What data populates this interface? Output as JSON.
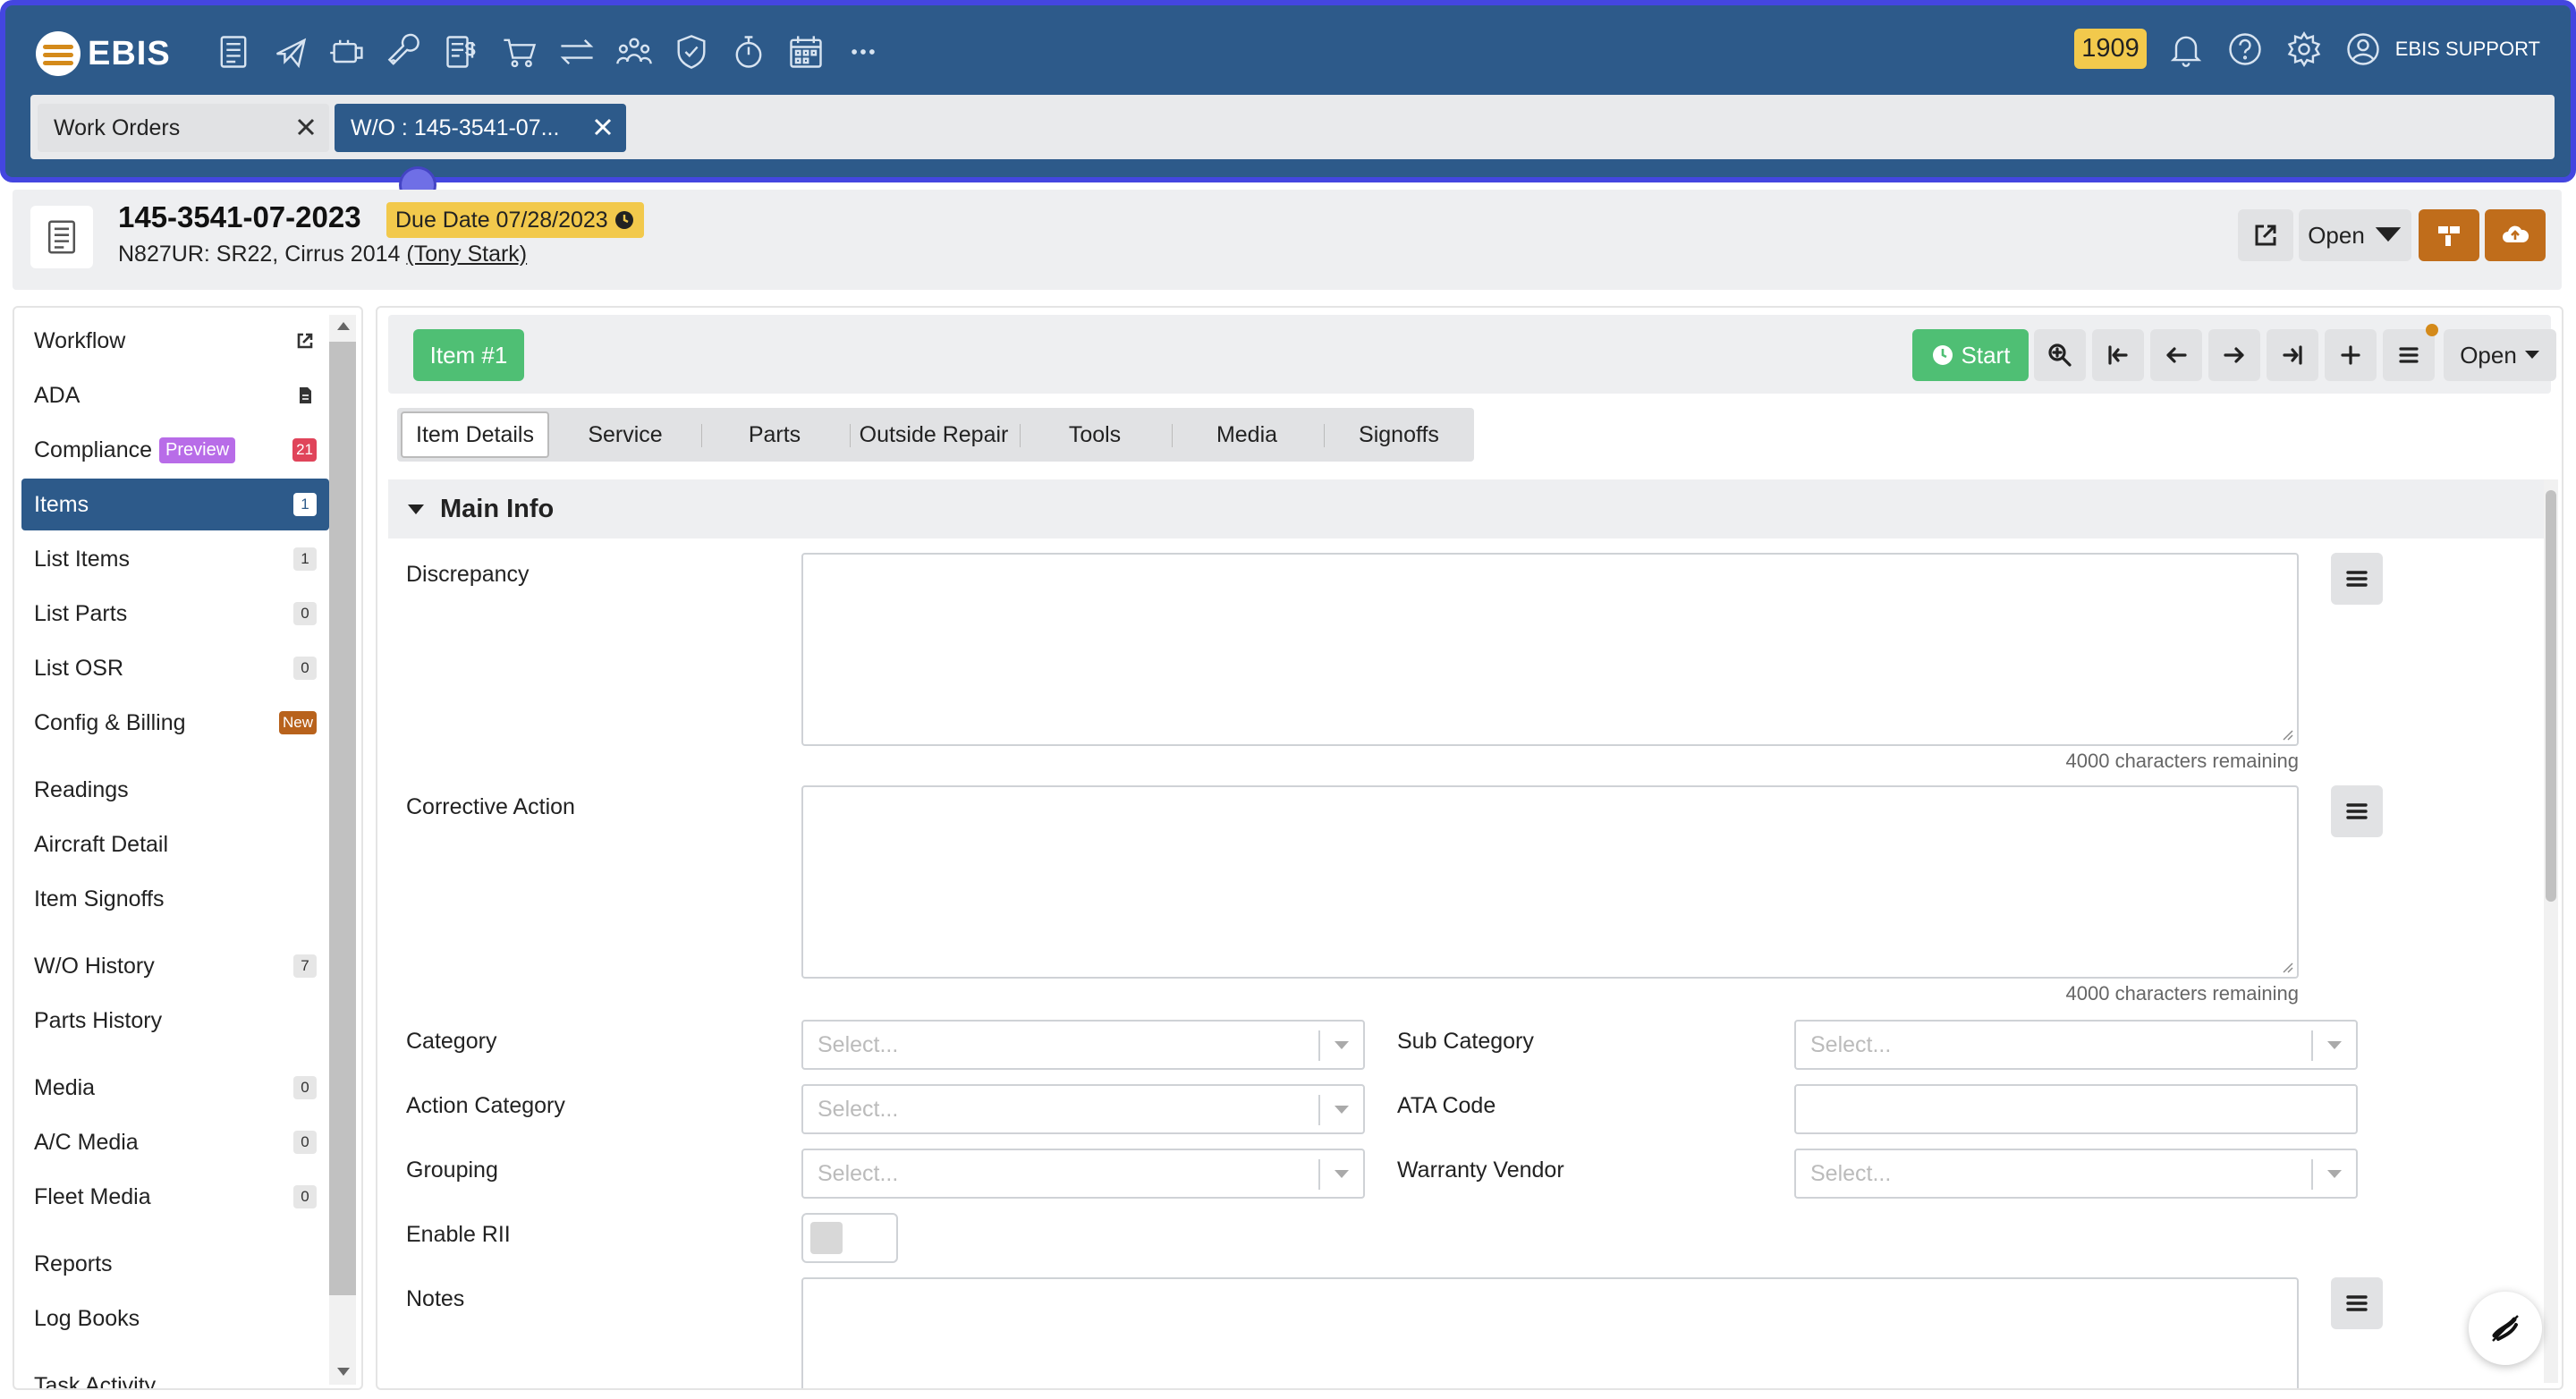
{
  "app": {
    "logo_text": "EBIS"
  },
  "topbar": {
    "nav_icons": [
      "document-icon",
      "airplane-icon",
      "engine-icon",
      "wrench-icon",
      "invoice-icon",
      "cart-icon",
      "transfer-icon",
      "people-icon",
      "shield-icon",
      "stopwatch-icon",
      "calendar-icon",
      "more-icon"
    ],
    "badge_count": "1909",
    "user_name": "EBIS SUPPORT"
  },
  "window_tabs": [
    {
      "label": "Work Orders",
      "active": false
    },
    {
      "label": "W/O : 145-3541-07...",
      "active": true
    }
  ],
  "work_order": {
    "number": "145-3541-07-2023",
    "due_date": "Due Date 07/28/2023",
    "aircraft": "N827UR: SR22, Cirrus 2014",
    "customer": "(Tony Stark)",
    "status_label": "Open"
  },
  "sidebar": {
    "items": [
      {
        "label": "Workflow",
        "icon": "external-link-icon"
      },
      {
        "label": "ADA",
        "icon": "file-icon"
      },
      {
        "label": "Compliance",
        "tag": "Preview",
        "badge": "21"
      },
      {
        "label": "Items",
        "badge": "1",
        "active": true
      },
      {
        "label": "List Items",
        "badge": "1"
      },
      {
        "label": "List Parts",
        "badge": "0"
      },
      {
        "label": "List OSR",
        "badge": "0"
      },
      {
        "label": "Config & Billing",
        "badge": "New"
      },
      {
        "label": "Readings"
      },
      {
        "label": "Aircraft Detail"
      },
      {
        "label": "Item Signoffs"
      },
      {
        "label": "W/O History",
        "badge": "7"
      },
      {
        "label": "Parts History"
      },
      {
        "label": "Media",
        "badge": "0"
      },
      {
        "label": "A/C Media",
        "badge": "0"
      },
      {
        "label": "Fleet Media",
        "badge": "0"
      },
      {
        "label": "Reports"
      },
      {
        "label": "Log Books"
      },
      {
        "label": "Task Activity"
      }
    ]
  },
  "item_toolbar": {
    "item_label": "Item #1",
    "start_label": "Start",
    "open_label": "Open"
  },
  "subtabs": [
    "Item Details",
    "Service",
    "Parts",
    "Outside Repair",
    "Tools",
    "Media",
    "Signoffs"
  ],
  "section": {
    "title": "Main Info"
  },
  "form": {
    "discrepancy_label": "Discrepancy",
    "discrepancy_value": "",
    "discrepancy_remaining": "4000 characters remaining",
    "corrective_label": "Corrective Action",
    "corrective_value": "",
    "corrective_remaining": "4000 characters remaining",
    "category_label": "Category",
    "sub_category_label": "Sub Category",
    "action_category_label": "Action Category",
    "ata_code_label": "ATA Code",
    "ata_code_value": "",
    "grouping_label": "Grouping",
    "warranty_vendor_label": "Warranty Vendor",
    "enable_rii_label": "Enable RII",
    "notes_label": "Notes",
    "select_placeholder": "Select..."
  },
  "colors": {
    "brand": "#2d5a8a",
    "accent_green": "#4fbf74",
    "accent_orange": "#c06d1b",
    "due_yellow": "#f2c94c"
  }
}
